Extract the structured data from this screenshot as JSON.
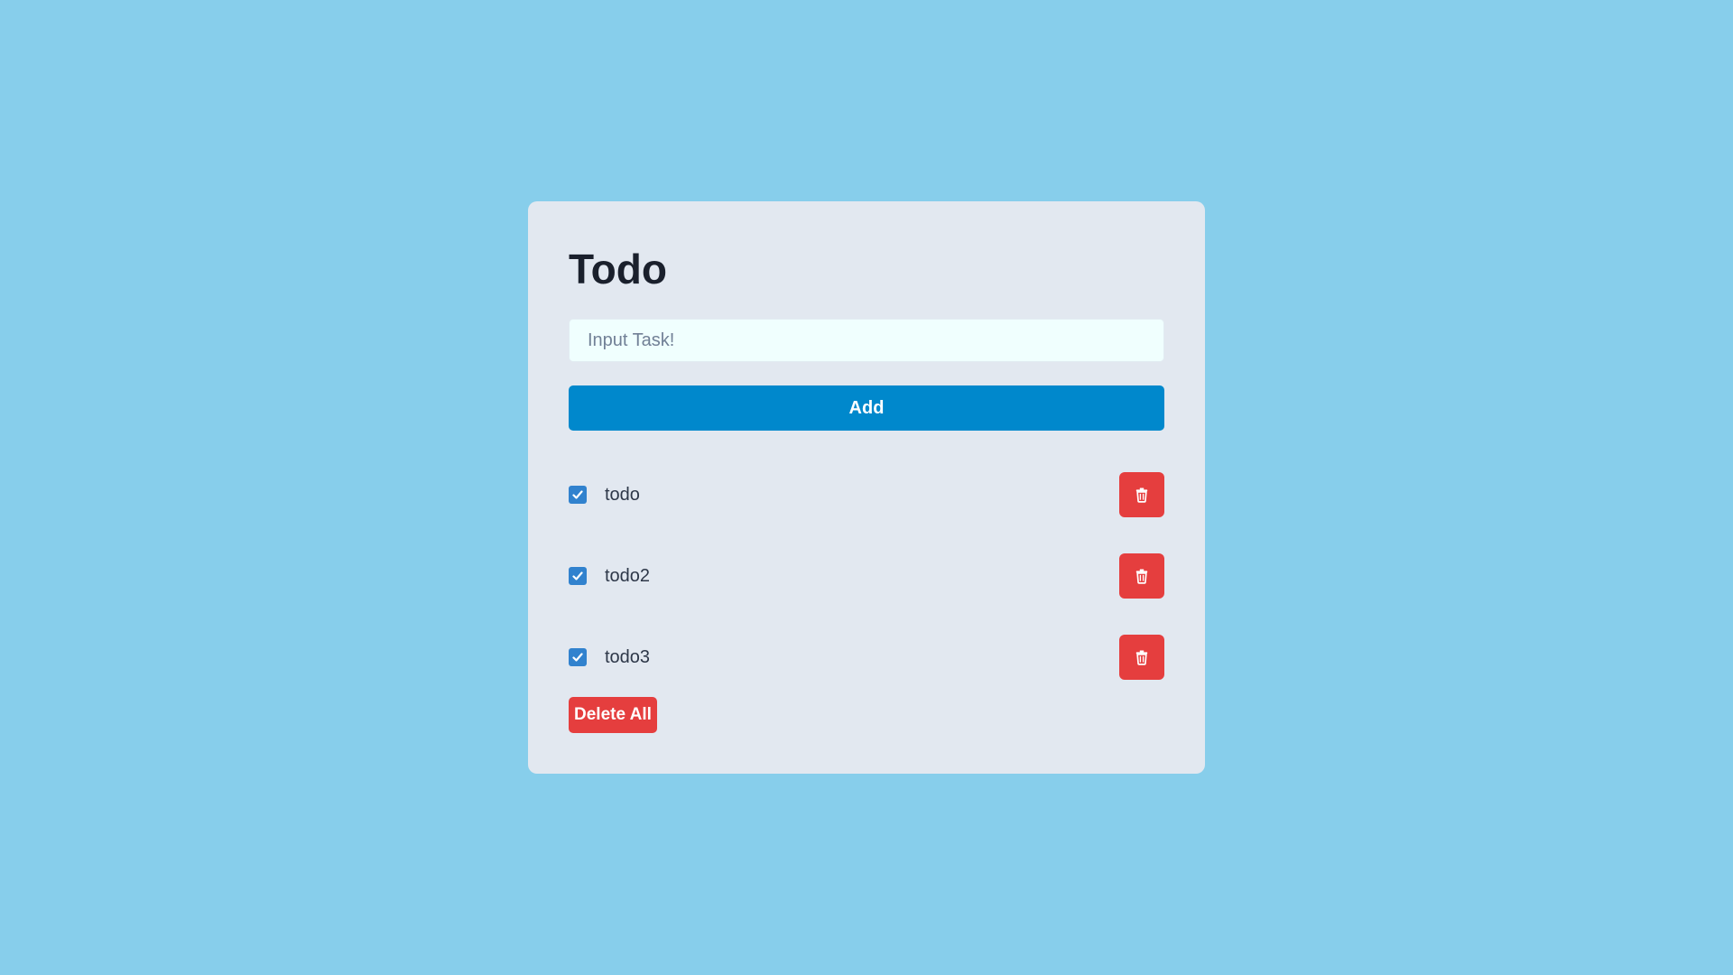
{
  "colors": {
    "page_background": "#87ceeb",
    "card_background": "#e2e8f0",
    "input_background": "#f0fffe",
    "accent": "#0088cc",
    "danger": "#e53e3e",
    "checkbox": "#3182ce"
  },
  "header": {
    "title": "Todo"
  },
  "task_input": {
    "value": "",
    "placeholder": "Input Task!"
  },
  "add_button": {
    "label": "Add"
  },
  "todos": [
    {
      "label": "todo",
      "checked": true,
      "delete_icon": "trash-icon"
    },
    {
      "label": "todo2",
      "checked": true,
      "delete_icon": "trash-icon"
    },
    {
      "label": "todo3",
      "checked": true,
      "delete_icon": "trash-icon"
    }
  ],
  "delete_all_button": {
    "label": "Delete All"
  }
}
